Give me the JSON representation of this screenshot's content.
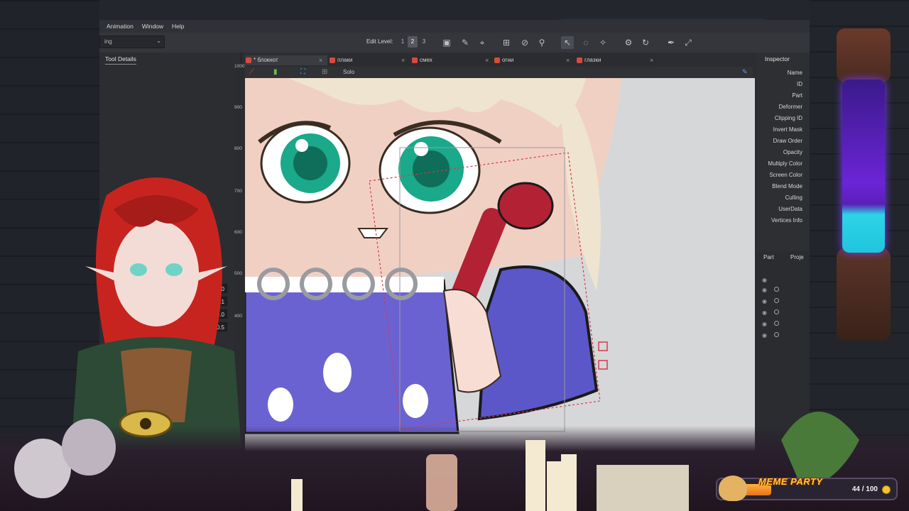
{
  "menu": {
    "items": [
      "Animation",
      "Window",
      "Help"
    ]
  },
  "toolbar": {
    "mode_value": "ing",
    "edit_level_label": "Edit Level:",
    "levels": [
      "1",
      "2",
      "3"
    ],
    "active_level": "2"
  },
  "left_panel": {
    "tab_label": "Tool Details",
    "values": [
      "-30.0",
      "-2.1",
      "0.0",
      "0.5"
    ]
  },
  "doc_tabs": [
    {
      "label": "* блокнот",
      "active": true
    },
    {
      "label": "плаки",
      "active": false
    },
    {
      "label": "смех",
      "active": false
    },
    {
      "label": "огни",
      "active": false
    },
    {
      "label": "глазки",
      "active": false
    }
  ],
  "view_toolbar": {
    "solo_label": "Solo"
  },
  "ruler": {
    "ticks": [
      "1000",
      "900",
      "800",
      "700",
      "600",
      "500",
      "400"
    ]
  },
  "inspector": {
    "title": "Inspector",
    "rows": [
      "Name",
      "ID",
      "Part",
      "Deformer",
      "Clipping ID",
      "Invert Mask",
      "Draw Order",
      "Opacity",
      "Multiply Color",
      "Screen Color",
      "Blend Mode",
      "Culling",
      "UserData",
      "Vertices Info"
    ]
  },
  "parts_panel": {
    "tabs": [
      "Part",
      "Proje"
    ]
  },
  "meme_party": {
    "title": "MEME PARTY",
    "count": "44 / 100",
    "progress": 0.44
  },
  "colors": {
    "accent_cyan": "#3cc0ff",
    "potion_purple": "#6b24d6",
    "potion_cyan": "#2ed3e8",
    "meme_orange": "#e8731a"
  }
}
